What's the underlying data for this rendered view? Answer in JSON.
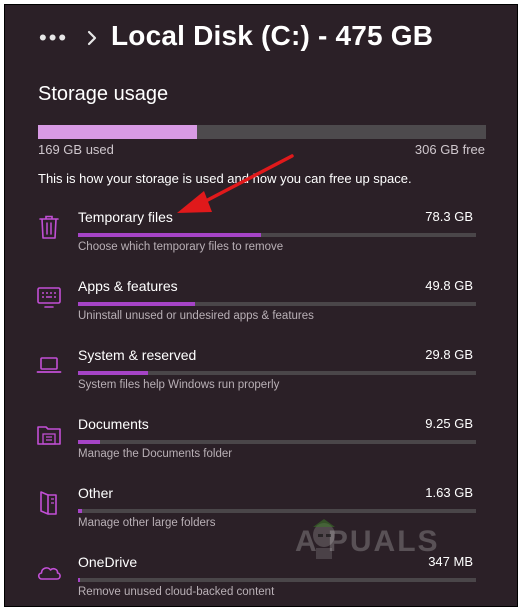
{
  "header": {
    "title": "Local Disk (C:) - 475 GB",
    "more_icon": "more-dots-icon",
    "chevron_icon": "chevron-right-icon"
  },
  "storage": {
    "section_title": "Storage usage",
    "used_label": "169 GB used",
    "free_label": "306 GB free",
    "used_fraction": 0.355,
    "info_text": "This is how your storage is used and how you can free up space."
  },
  "categories": [
    {
      "icon": "trash-icon",
      "name": "Temporary files",
      "size": "78.3 GB",
      "description": "Choose which temporary files to remove",
      "fill_fraction": 0.46
    },
    {
      "icon": "apps-icon",
      "name": "Apps & features",
      "size": "49.8 GB",
      "description": "Uninstall unused or undesired apps & features",
      "fill_fraction": 0.295
    },
    {
      "icon": "laptop-icon",
      "name": "System & reserved",
      "size": "29.8 GB",
      "description": "System files help Windows run properly",
      "fill_fraction": 0.175
    },
    {
      "icon": "folder-icon",
      "name": "Documents",
      "size": "9.25 GB",
      "description": "Manage the Documents folder",
      "fill_fraction": 0.055
    },
    {
      "icon": "other-file-icon",
      "name": "Other",
      "size": "1.63 GB",
      "description": "Manage other large folders",
      "fill_fraction": 0.01
    },
    {
      "icon": "cloud-icon",
      "name": "OneDrive",
      "size": "347 MB",
      "description": "Remove unused cloud-backed content",
      "fill_fraction": 0.004
    }
  ],
  "watermark": {
    "text": "A PUALS"
  },
  "colors": {
    "background": "#2b2027",
    "usage_fill": "#d89ae4",
    "category_fill": "#a644c7",
    "icon": "#c24fd6",
    "annotation_arrow": "#e0191b"
  }
}
